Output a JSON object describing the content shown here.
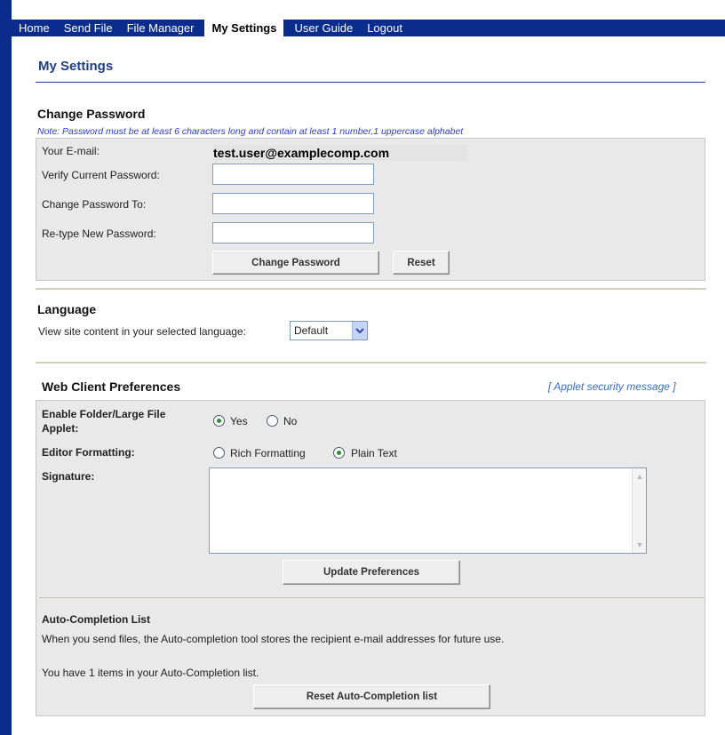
{
  "nav": {
    "items": [
      {
        "label": "Home"
      },
      {
        "label": "Send File"
      },
      {
        "label": "File Manager"
      },
      {
        "label": "My Settings"
      },
      {
        "label": "User Guide"
      },
      {
        "label": "Logout"
      }
    ],
    "active": "My Settings"
  },
  "page_title": "My Settings",
  "change_password": {
    "heading": "Change Password",
    "note": "Note: Password must be at least 6 characters long and contain at least 1 number,1 uppercase alphabet",
    "email_label": "Your E-mail:",
    "email_value": "test.user@examplecomp.com",
    "verify_label": "Verify Current Password:",
    "change_label": "Change Password To:",
    "retype_label": "Re-type New Password:",
    "submit_button": "Change Password",
    "reset_button": "Reset"
  },
  "language": {
    "heading": "Language",
    "description": "View site content in your selected language:",
    "selected": "Default"
  },
  "web_client": {
    "heading": "Web Client Preferences",
    "applet_link": "[ Applet security message ]",
    "applet_label": "Enable Folder/Large File Applet:",
    "applet_yes": "Yes",
    "applet_no": "No",
    "applet_value": "Yes",
    "editor_label": "Editor Formatting:",
    "editor_rich": "Rich Formatting",
    "editor_plain": "Plain Text",
    "editor_value": "Plain Text",
    "signature_label": "Signature:",
    "signature_value": "",
    "update_button": "Update Preferences"
  },
  "autocomplete": {
    "heading": "Auto-Completion List",
    "description": "When you send files, the Auto-completion tool stores the recipient e-mail addresses for future use.",
    "count_text": "You have 1 items in your Auto-Completion list.",
    "reset_button": "Reset Auto-Completion list"
  }
}
